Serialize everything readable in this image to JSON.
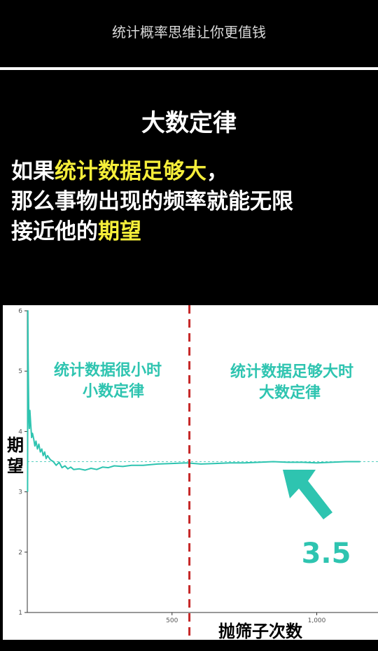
{
  "header": {
    "title": "统计概率思维让你更值钱"
  },
  "main": {
    "heading": "大数定律",
    "statement": {
      "line1_pre": "如果",
      "line1_highlight": "统计数据足够大",
      "line1_post": "，",
      "line2": "那么事物出现的频率就能无限",
      "line3_pre": "接近他的",
      "line3_highlight": "期望"
    }
  },
  "colors": {
    "background": "#000000",
    "highlight": "#f5ee3a",
    "series": "#2ec4b0",
    "divider": "#c62828"
  },
  "chart_data": {
    "type": "line",
    "xlabel": "抛筛子次数",
    "ylabel": "期望",
    "xlim": [
      0,
      1200
    ],
    "ylim": [
      1,
      6
    ],
    "x_ticks": [
      {
        "value": 500,
        "label": "500"
      },
      {
        "value": 1000,
        "label": "1,000"
      }
    ],
    "y_ticks": [
      {
        "value": 1,
        "label": "1"
      },
      {
        "value": 2,
        "label": "2"
      },
      {
        "value": 3,
        "label": "3"
      },
      {
        "value": 4,
        "label": "4"
      },
      {
        "value": 5,
        "label": "5"
      },
      {
        "value": 6,
        "label": "6"
      }
    ],
    "reference_line": {
      "y": 3.5
    },
    "divider_x": 560,
    "annotations": {
      "left_line1": "统计数据很小时",
      "left_line2": "小数定律",
      "right_line1": "统计数据足够大时",
      "right_line2": "大数定律",
      "value_label": "3.5"
    },
    "series": [
      {
        "x": [
          1,
          2,
          3,
          5,
          7,
          9,
          12,
          15,
          18,
          22,
          26,
          30,
          35,
          40,
          45,
          50,
          55,
          60,
          65,
          70,
          80,
          90,
          100,
          110,
          120,
          130,
          140,
          150,
          160,
          180,
          200,
          220,
          240,
          260,
          280,
          300,
          330,
          360,
          400,
          450,
          500,
          550,
          600,
          650,
          700,
          750,
          800,
          850,
          900,
          950,
          1000,
          1050,
          1100,
          1150
        ],
        "y": [
          3.0,
          6.0,
          5.2,
          4.3,
          4.05,
          4.35,
          4.1,
          3.9,
          3.97,
          3.88,
          3.76,
          3.84,
          3.71,
          3.79,
          3.66,
          3.71,
          3.6,
          3.66,
          3.55,
          3.6,
          3.53,
          3.5,
          3.44,
          3.49,
          3.4,
          3.43,
          3.38,
          3.41,
          3.37,
          3.38,
          3.36,
          3.39,
          3.37,
          3.41,
          3.4,
          3.43,
          3.42,
          3.44,
          3.44,
          3.46,
          3.47,
          3.48,
          3.46,
          3.47,
          3.48,
          3.48,
          3.49,
          3.5,
          3.49,
          3.49,
          3.48,
          3.49,
          3.5,
          3.5
        ]
      }
    ]
  }
}
